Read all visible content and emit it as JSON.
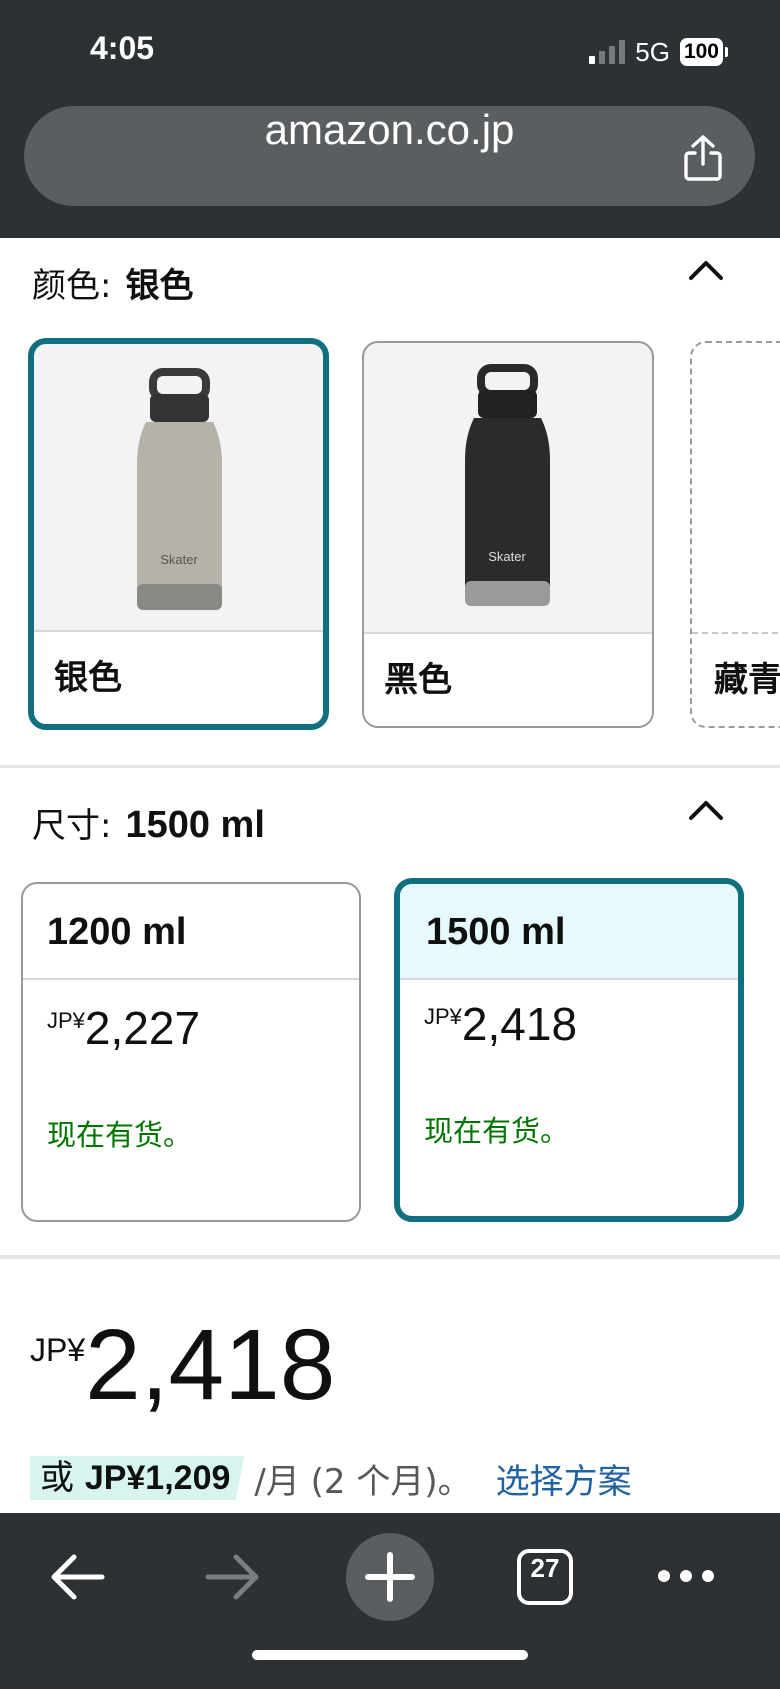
{
  "status_bar": {
    "time": "4:05",
    "network": "5G",
    "battery": "100"
  },
  "browser": {
    "url": "amazon.co.jp",
    "tab_count": "27"
  },
  "color_section": {
    "label": "颜色:",
    "selected_value": "银色",
    "options": [
      {
        "label": "银色",
        "selected": true,
        "bottle_color": "#b5b2aa"
      },
      {
        "label": "黑色",
        "selected": false,
        "bottle_color": "#2b2b2d"
      },
      {
        "label": "藏青",
        "selected": false
      }
    ],
    "brand_text": "Skater"
  },
  "size_section": {
    "label": "尺寸:",
    "selected_value": "1500 ml",
    "options": [
      {
        "size": "1200 ml",
        "currency": "JP¥",
        "price": "2,227",
        "stock": "现在有货。",
        "selected": false
      },
      {
        "size": "1500 ml",
        "currency": "JP¥",
        "price": "2,418",
        "stock": "现在有货。",
        "selected": true
      }
    ]
  },
  "price": {
    "currency": "JP¥",
    "value": "2,418",
    "installment_prefix": "或",
    "installment_amount": "JP¥1,209",
    "installment_suffix": "/月 (2 个月)。",
    "installment_link": "选择方案"
  },
  "colors": {
    "accent_teal": "#10707f",
    "stock_green": "#007600",
    "link_blue": "#2162a1",
    "chrome_dark": "#2e3134"
  }
}
